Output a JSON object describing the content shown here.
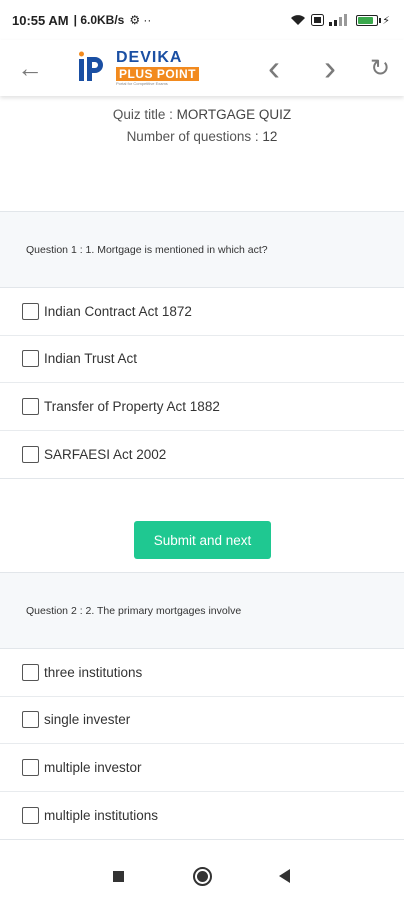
{
  "status_bar": {
    "time": "10:55 AM",
    "speed": "6.0KB/s",
    "extra": "⚙ ··",
    "battery_level": 0.8
  },
  "app_bar": {
    "logo_line1": "DEVIKA",
    "logo_line2": "PLUS POINT",
    "logo_tagline": "Portal for Competitive Exams",
    "back_icon": "←",
    "prev_icon": "‹",
    "next_icon": "›",
    "reload_icon": "↻"
  },
  "quiz": {
    "title_label": "Quiz title : ",
    "title_value": "MORTGAGE QUIZ",
    "count_label": "Number of questions : ",
    "count_value": "12"
  },
  "questions": [
    {
      "text": "Question 1 : 1. Mortgage is mentioned in which act?",
      "options": [
        "Indian Contract Act 1872",
        "Indian Trust Act",
        "Transfer of Property Act 1882",
        "SARFAESI Act 2002"
      ]
    },
    {
      "text": "Question 2 : 2. The primary mortgages involve",
      "options": [
        "three institutions",
        "single invester",
        "multiple investor",
        "multiple institutions"
      ]
    }
  ],
  "submit_label": "Submit and next",
  "colors": {
    "accent": "#1fc891",
    "brand_blue": "#1a4fa3",
    "brand_orange": "#f28a1e"
  }
}
